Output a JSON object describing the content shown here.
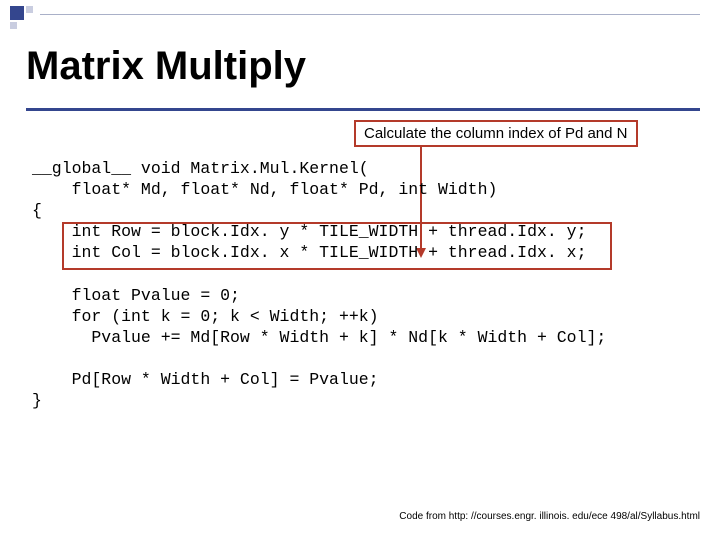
{
  "title": "Matrix Multiply",
  "callout": "Calculate the column index of Pd and N",
  "code": {
    "l0": "__global__ void Matrix.Mul.Kernel(",
    "l1": "    float* Md, float* Nd, float* Pd, int Width)",
    "l2": "{",
    "l3": "    int Row = block.Idx. y * TILE_WIDTH + thread.Idx. y;",
    "l4": "    int Col = block.Idx. x * TILE_WIDTH + thread.Idx. x;",
    "l5": "",
    "l6": "    float Pvalue = 0;",
    "l7": "    for (int k = 0; k < Width; ++k)",
    "l8": "      Pvalue += Md[Row * Width + k] * Nd[k * Width + Col];",
    "l9": "",
    "l10": "    Pd[Row * Width + Col] = Pvalue;",
    "l11": "}"
  },
  "footer": "Code from http: //courses.engr. illinois. edu/ece 498/al/Syllabus.html"
}
